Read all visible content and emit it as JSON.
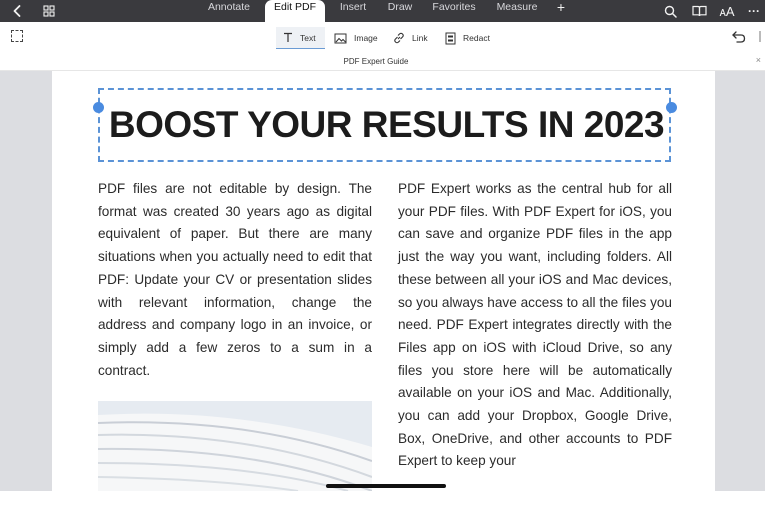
{
  "topbar": {
    "tabs": [
      {
        "label": "Annotate",
        "active": false
      },
      {
        "label": "Edit PDF",
        "active": true
      },
      {
        "label": "Insert",
        "active": false
      },
      {
        "label": "Draw",
        "active": false
      },
      {
        "label": "Favorites",
        "active": false
      },
      {
        "label": "Measure",
        "active": false
      }
    ],
    "add_tab": "+",
    "icons": [
      "back-chevron-icon",
      "grid-icon",
      "search-icon",
      "book-icon",
      "text-size-icon",
      "more-icon"
    ],
    "text_size_label": "ᴀA",
    "more_label": "···"
  },
  "toolbar": {
    "tools": [
      {
        "label": "Text",
        "icon": "text-icon",
        "active": true
      },
      {
        "label": "Image",
        "icon": "image-icon",
        "active": false
      },
      {
        "label": "Link",
        "icon": "link-icon",
        "active": false
      },
      {
        "label": "Redact",
        "icon": "redact-icon",
        "active": false
      }
    ]
  },
  "document": {
    "title": "PDF Expert Guide",
    "close_label": "×",
    "headline": "BOOST YOUR RESULTS IN 2023",
    "left_column": "PDF files are not editable by design. The format was created 30 years ago as digital equivalent of paper. But there are many situations when you actually need to edit that PDF: Update your CV or presentation slides with relevant information, change the address and company logo in an invoice, or simply add a few zeros to a sum in a contract.",
    "right_column": "PDF Expert works as the central hub for all your PDF files. With PDF Expert for iOS, you can save and organize PDF files in the app just the way you want, including folders. All these between all your iOS and Mac devices, so you always have access to all the files you need. PDF Expert integrates directly with the Files app on iOS with iCloud Drive, so any files you store here will be automatically available on your iOS and Mac. Additionally, you can add your Dropbox, Google Drive, Box, OneDrive, and other accounts to PDF Expert to keep your"
  },
  "colors": {
    "topbar": "#3a3a3e",
    "accent": "#4a8be0",
    "canvas": "#dcdde1"
  }
}
